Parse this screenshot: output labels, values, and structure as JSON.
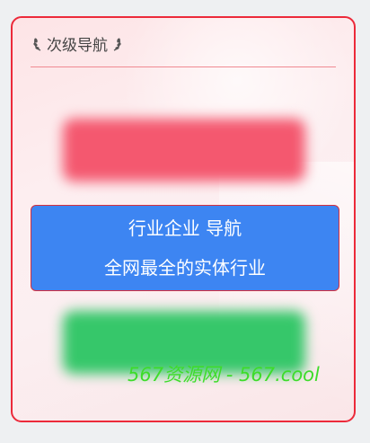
{
  "section": {
    "title": "次级导航"
  },
  "nav_box": {
    "line1": "行业企业 导航",
    "line2": "全网最全的实体行业"
  },
  "watermark": {
    "text": "567资源网 - 567.cool"
  },
  "colors": {
    "border": "#ec2a3a",
    "blurred_top_button": "#f4586f",
    "nav_box_bg": "#3d85f2",
    "blurred_bottom_button": "#36c76a",
    "watermark": "#3ddc2a"
  },
  "icons": {
    "left": "laurel-left-icon",
    "right": "laurel-right-icon"
  }
}
